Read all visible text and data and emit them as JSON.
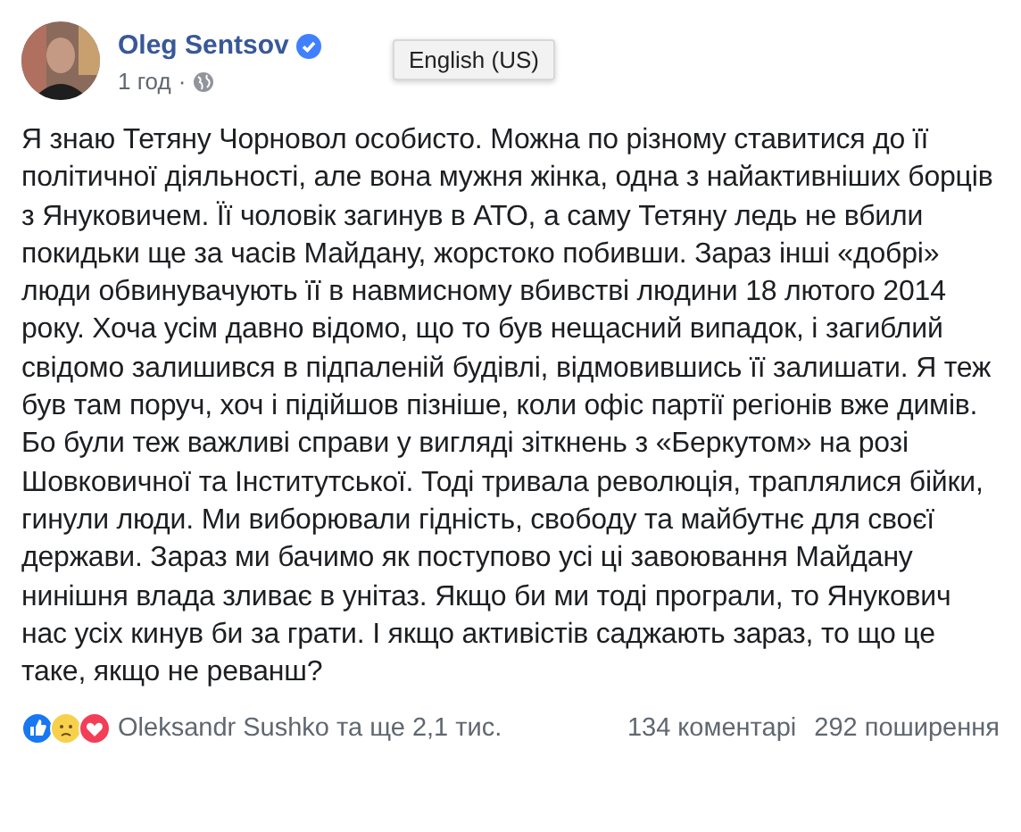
{
  "post": {
    "author": "Oleg Sentsov",
    "verified": true,
    "time": "1 год",
    "separator": "·",
    "text": "Я знаю Тетяну Чорновол особисто. Можна по різному ставитися до її політичної діяльності, але вона мужня жінка, одна з найактивніших борців з Януковичем. Її чоловік загинув в АТО, а саму Тетяну ледь не вбили покидьки ще за часів Майдану, жорстоко побивши. Зараз інші «добрі» люди обвинувачують її в навмисному вбивстві людини 18 лютого 2014 року. Хоча усім давно відомо, що то був нещасний випадок, і загиблий свідомо залишився в підпаленій будівлі, відмовившись її залишати. Я теж був там поруч, хоч і підійшов пізніше, коли офіс партії регіонів вже димів. Бо були теж важливі справи у вигляді зіткнень з «Беркутом» на розі Шовковичної та Інститутської. Тоді тривала революція, траплялися бійки, гинули люди. Ми виборювали гідність, свободу та майбутнє для своєї держави. Зараз ми бачимо як поступово усі ці завоювання Майдану нинішня влада зливає в унітаз. Якщо би ми тоді програли, то Янукович нас усіх кинув би за грати. І якщо активістів саджають зараз, то що це таке, якщо не реванш?"
  },
  "tooltip": "English (US)",
  "footer": {
    "reactions": [
      {
        "kind": "like"
      },
      {
        "kind": "sad"
      },
      {
        "kind": "love"
      }
    ],
    "reactors": "Oleksandr Sushko та ще 2,1 тис.",
    "comments": "134 коментарі",
    "shares": "292 поширення"
  }
}
